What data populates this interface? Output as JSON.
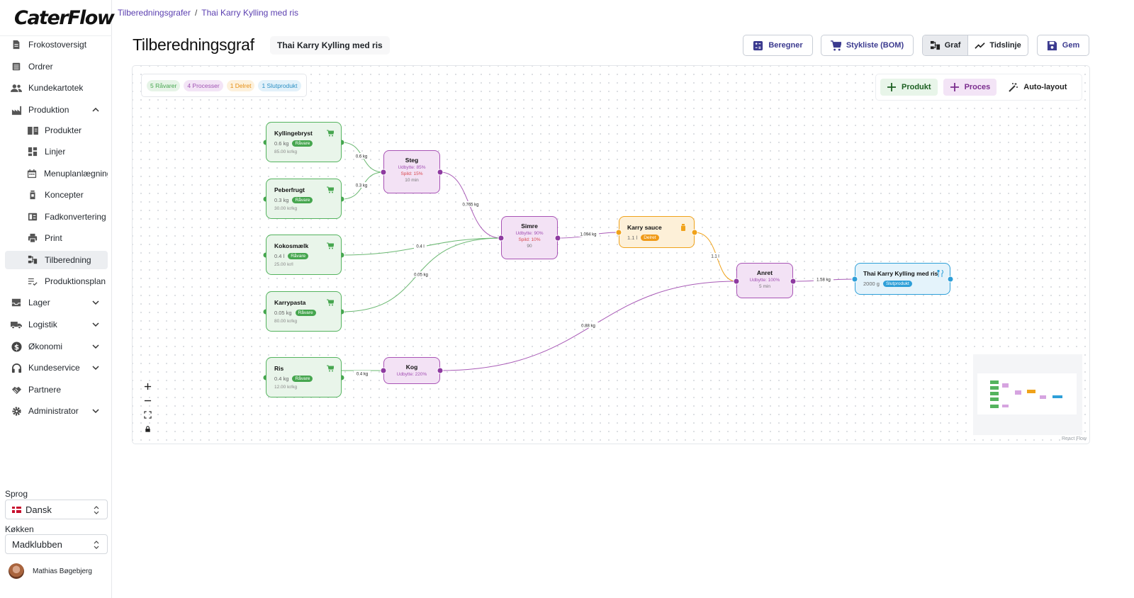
{
  "app": {
    "logo": "CaterFlow"
  },
  "sidebar": {
    "items": [
      {
        "label": "Frokostoversigt",
        "icon": "document-icon"
      },
      {
        "label": "Ordrer",
        "icon": "list-icon"
      },
      {
        "label": "Kundekartotek",
        "icon": "people-icon"
      },
      {
        "label": "Produktion",
        "icon": "factory-icon",
        "expanded": true
      },
      {
        "label": "Produkter",
        "icon": "book-icon"
      },
      {
        "label": "Linjer",
        "icon": "dashboard-icon"
      },
      {
        "label": "Menuplanlægning",
        "icon": "calendar-icon"
      },
      {
        "label": "Koncepter",
        "icon": "bottle-icon"
      },
      {
        "label": "Fadkonvertering",
        "icon": "convert-icon"
      },
      {
        "label": "Print",
        "icon": "printer-icon"
      },
      {
        "label": "Tilberedning",
        "icon": "graph-icon",
        "active": true
      },
      {
        "label": "Produktionsplan",
        "icon": "checklist-icon"
      },
      {
        "label": "Lager",
        "icon": "inbox-icon"
      },
      {
        "label": "Logistik",
        "icon": "truck-icon"
      },
      {
        "label": "Økonomi",
        "icon": "dollar-icon"
      },
      {
        "label": "Kundeservice",
        "icon": "headset-icon"
      },
      {
        "label": "Partnere",
        "icon": "handshake-icon"
      },
      {
        "label": "Administrator",
        "icon": "gear-icon"
      }
    ],
    "language_label": "Sprog",
    "language_value": "Dansk",
    "kitchen_label": "Køkken",
    "kitchen_value": "Madklubben",
    "user_name": "Mathias Bøgebjerg"
  },
  "header": {
    "breadcrumb": [
      "Tilberedningsgrafer",
      "Thai Karry Kylling med ris"
    ],
    "title": "Tilberedningsgraf",
    "recipe": "Thai Karry Kylling med ris",
    "buttons": {
      "calculator": "Beregner",
      "bom": "Stykliste (BOM)",
      "graph": "Graf",
      "timeline": "Tidslinje",
      "save": "Gem"
    }
  },
  "canvas": {
    "legend": [
      {
        "label": "5 Råvarer",
        "color": "#46a64f",
        "bg": "#e6f4e7"
      },
      {
        "label": "4 Processer",
        "color": "#a053b3",
        "bg": "#f3e4f6"
      },
      {
        "label": "1 Delret",
        "color": "#e58e12",
        "bg": "#fdf1dc"
      },
      {
        "label": "1 Slutprodukt",
        "color": "#2a8fc4",
        "bg": "#e2f1fa"
      }
    ],
    "tools": {
      "product": "Produkt",
      "process": "Proces",
      "autolayout": "Auto-layout"
    },
    "raw_nodes": [
      {
        "name": "Kyllingebryst",
        "qty": "0.6 kg",
        "tag": "Råvare",
        "price": "85.00 kr/kg"
      },
      {
        "name": "Peberfrugt",
        "qty": "0.3 kg",
        "tag": "Råvare",
        "price": "30.00 kr/kg"
      },
      {
        "name": "Kokosmælk",
        "qty": "0.4 l",
        "tag": "Råvare",
        "price": "25.00 kr/l"
      },
      {
        "name": "Karrypasta",
        "qty": "0.05 kg",
        "tag": "Råvare",
        "price": "80.00 kr/kg"
      },
      {
        "name": "Ris",
        "qty": "0.4 kg",
        "tag": "Råvare",
        "price": "12.00 kr/kg"
      }
    ],
    "process_nodes": [
      {
        "name": "Steg",
        "yield": "Udbytte: 85%",
        "waste": "Spild: 15%",
        "time": "10 min"
      },
      {
        "name": "Simre",
        "yield": "Udbytte: 90%",
        "waste": "Spild: 10%",
        "time": "90"
      },
      {
        "name": "Kog",
        "yield": "Udbytte: 220%",
        "waste": "",
        "time": ""
      },
      {
        "name": "Anret",
        "yield": "Udbytte: 100%",
        "waste": "",
        "time": "5 min"
      }
    ],
    "semi_node": {
      "name": "Karry sauce",
      "qty": "1.1 l",
      "tag": "Delret"
    },
    "final_node": {
      "name": "Thai Karry Kylling med ris",
      "qty": "2000 g",
      "tag": "Slutprodukt"
    },
    "edge_labels": [
      "0.6 kg",
      "0.3 kg",
      "0.765 kg",
      "0.4 l",
      "0.05 kg",
      "1.094 kg",
      "1.1 l",
      "1.58 kg",
      "0.88 kg",
      "0.4 kg"
    ],
    "attribution": "React Flow"
  },
  "colors": {
    "raw": "#54b35e",
    "process": "#a853b5",
    "semi": "#f0a21a",
    "final": "#2e9fd8",
    "accent": "#3b3a8f"
  }
}
